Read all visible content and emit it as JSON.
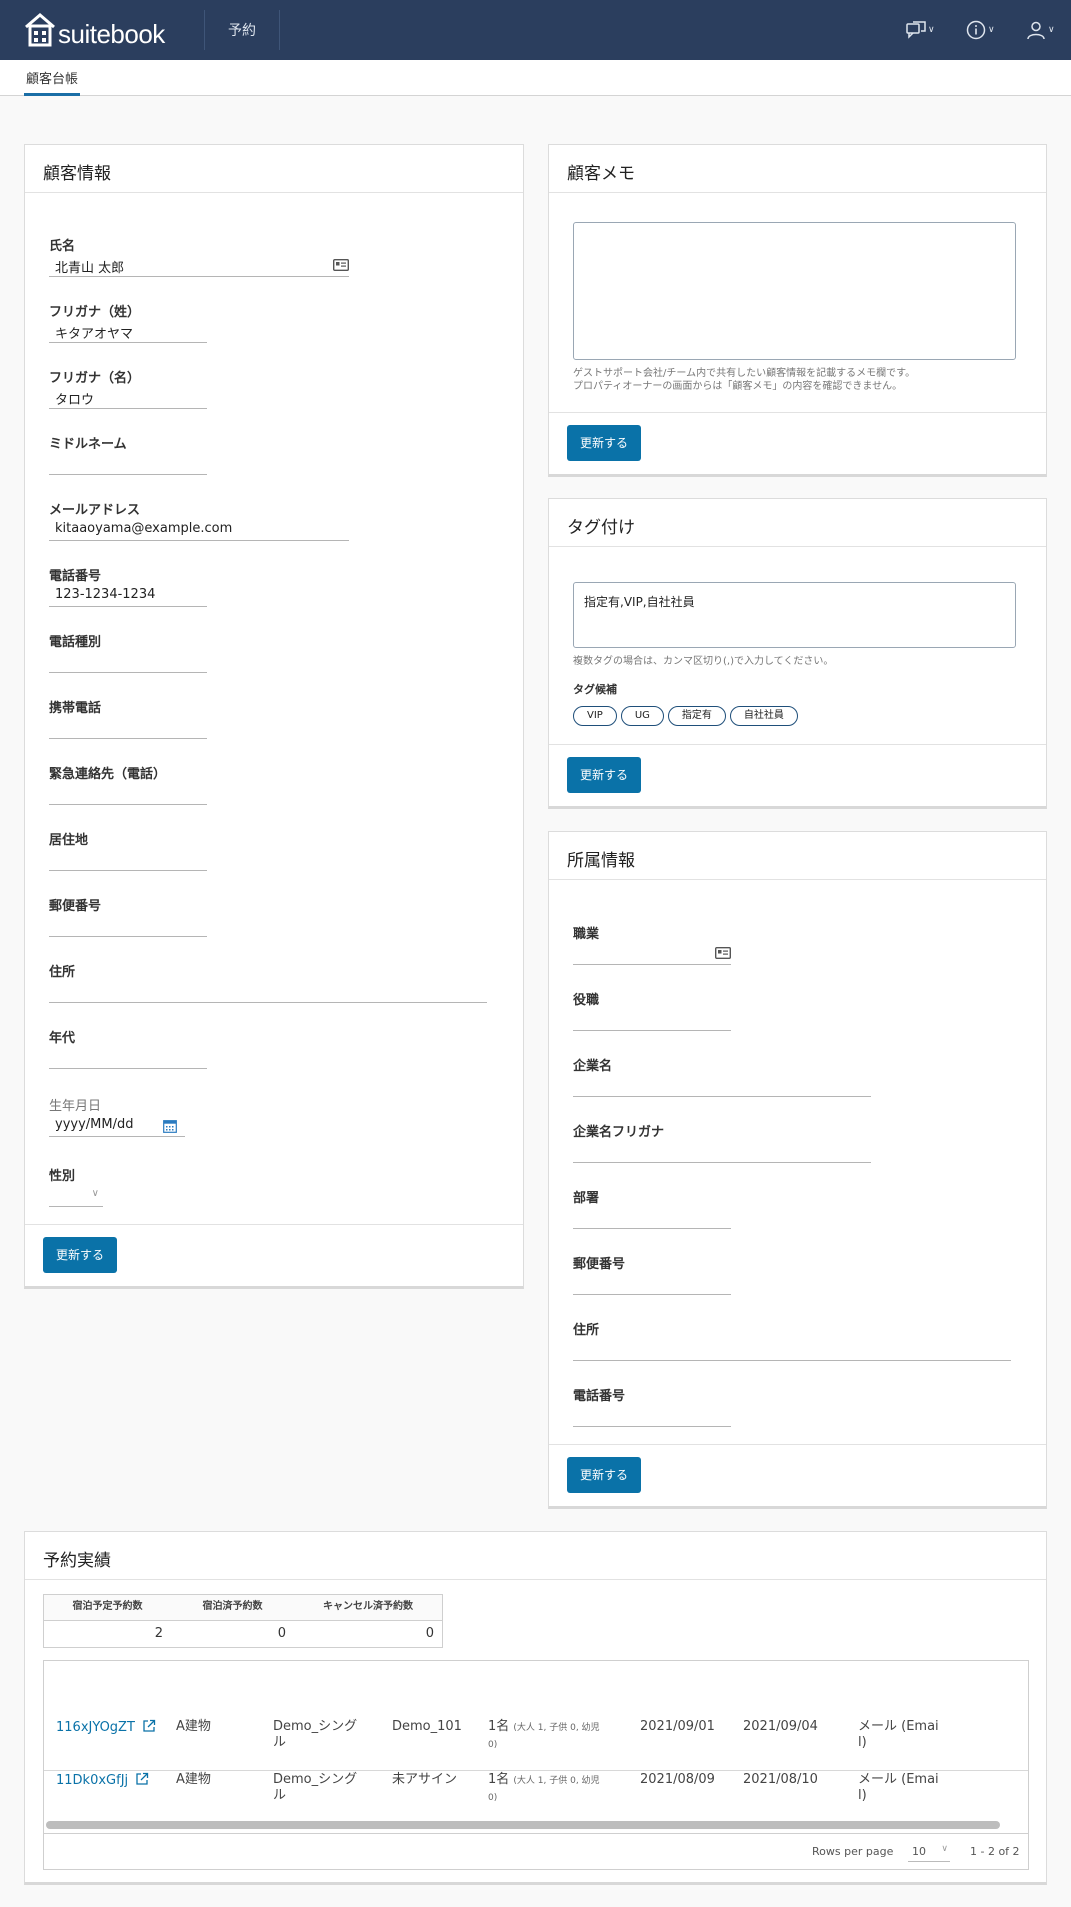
{
  "app": {
    "brand": "suitebook",
    "nav_reservation": "予約"
  },
  "subnav": {
    "tab": "顧客台帳"
  },
  "customer": {
    "title": "顧客情報",
    "fields": [
      {
        "label": "氏名",
        "value": "北青山 太郎"
      },
      {
        "label": "フリガナ（姓）",
        "value": "キタアオヤマ"
      },
      {
        "label": "フリガナ（名）",
        "value": "タロウ"
      },
      {
        "label": "ミドルネーム",
        "value": ""
      },
      {
        "label": "メールアドレス",
        "value": "kitaaoyama@example.com"
      },
      {
        "label": "電話番号",
        "value": "123-1234-1234"
      },
      {
        "label": "電話種別",
        "value": ""
      },
      {
        "label": "携帯電話",
        "value": ""
      },
      {
        "label": "緊急連絡先（電話）",
        "value": ""
      },
      {
        "label": "居住地",
        "value": ""
      },
      {
        "label": "郵便番号",
        "value": ""
      },
      {
        "label": "住所",
        "value": ""
      },
      {
        "label": "年代",
        "value": ""
      },
      {
        "label": "生年月日",
        "value": "yyyy/MM/dd"
      },
      {
        "label": "性別",
        "value": ""
      }
    ],
    "update": "更新する"
  },
  "memo": {
    "title": "顧客メモ",
    "value": "",
    "hint1": "ゲストサポート会社/チーム内で共有したい顧客情報を記載するメモ欄です。",
    "hint2": "プロパティオーナーの画面からは「顧客メモ」の内容を確認できません。",
    "update": "更新する"
  },
  "tags": {
    "title": "タグ付け",
    "value": "指定有,VIP,自社社員",
    "hint": "複数タグの場合は、カンマ区切り(,)で入力してください。",
    "candidates_label": "タグ候補",
    "candidates": [
      "VIP",
      "UG",
      "指定有",
      "自社社員"
    ],
    "update": "更新する"
  },
  "affiliation": {
    "title": "所属情報",
    "fields": [
      {
        "label": "職業",
        "value": ""
      },
      {
        "label": "役職",
        "value": ""
      },
      {
        "label": "企業名",
        "value": ""
      },
      {
        "label": "企業名フリガナ",
        "value": ""
      },
      {
        "label": "部署",
        "value": ""
      },
      {
        "label": "郵便番号",
        "value": ""
      },
      {
        "label": "住所",
        "value": ""
      },
      {
        "label": "電話番号",
        "value": ""
      }
    ],
    "update": "更新する"
  },
  "history": {
    "title": "予約実績",
    "stats_headers": [
      "宿泊予定予約数",
      "宿泊済予約数",
      "キャンセル済予約数"
    ],
    "stats_values": [
      "2",
      "0",
      "0"
    ],
    "rows": [
      {
        "id": "116xJYOgZT",
        "building": "A建物",
        "plan1": "Demo_シング",
        "plan2": "ル",
        "room": "Demo_101",
        "guests": "1名",
        "guests_detail1": "(大人 1, 子供 0, 幼児",
        "guests_detail2": "0)",
        "checkin": "2021/09/01",
        "checkout": "2021/09/04",
        "channel1": "メール (Emai",
        "channel2": "l)"
      },
      {
        "id": "11Dk0xGfJj",
        "building": "A建物",
        "plan1": "Demo_シング",
        "plan2": "ル",
        "room": "未アサイン",
        "guests": "1名",
        "guests_detail1": "(大人 1, 子供 0, 幼児",
        "guests_detail2": "0)",
        "checkin": "2021/08/09",
        "checkout": "2021/08/10",
        "channel1": "メール (Emai",
        "channel2": "l)"
      }
    ],
    "rows_per_page_label": "Rows per page",
    "rows_per_page": "10",
    "range": "1 - 2 of 2"
  }
}
